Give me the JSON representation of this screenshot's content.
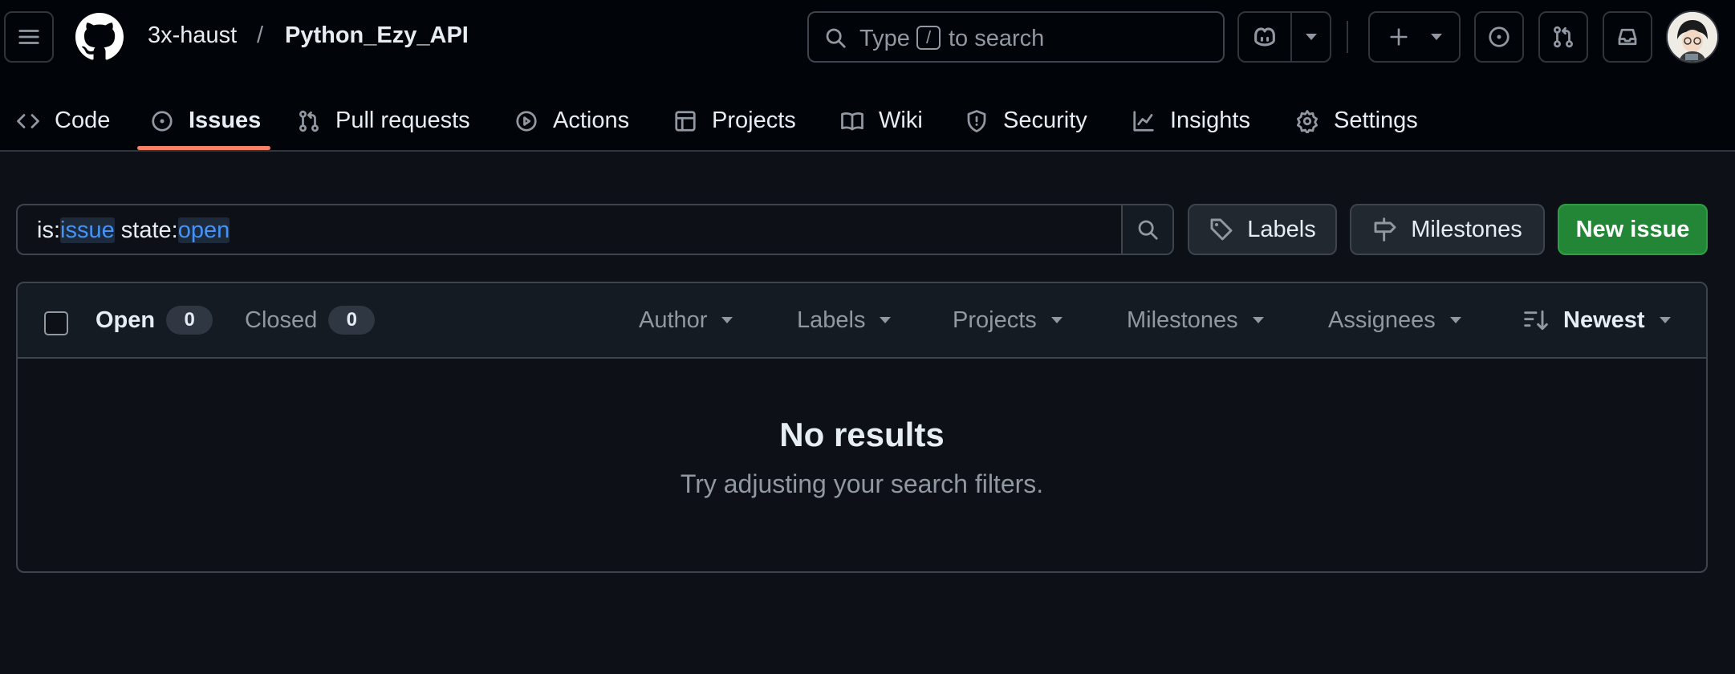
{
  "header": {
    "owner": "3x-haust",
    "separator": "/",
    "repo": "Python_Ezy_API",
    "search": {
      "prefix": "Type",
      "key": "/",
      "suffix": "to search"
    }
  },
  "tabs": [
    {
      "label": "Code",
      "icon": "code-icon"
    },
    {
      "label": "Issues",
      "icon": "issue-opened-icon",
      "active": true
    },
    {
      "label": "Pull requests",
      "icon": "git-pull-request-icon"
    },
    {
      "label": "Actions",
      "icon": "play-icon"
    },
    {
      "label": "Projects",
      "icon": "table-icon"
    },
    {
      "label": "Wiki",
      "icon": "book-icon"
    },
    {
      "label": "Security",
      "icon": "shield-icon"
    },
    {
      "label": "Insights",
      "icon": "graph-icon"
    },
    {
      "label": "Settings",
      "icon": "gear-icon"
    }
  ],
  "filter": {
    "parts": [
      {
        "text": "is:",
        "type": "key"
      },
      {
        "text": "issue",
        "type": "value"
      },
      {
        "text": " state:",
        "type": "key"
      },
      {
        "text": "open",
        "type": "value"
      }
    ]
  },
  "buttons": {
    "labels": "Labels",
    "milestones": "Milestones",
    "new_issue": "New issue"
  },
  "issues": {
    "open_label": "Open",
    "open_count": "0",
    "closed_label": "Closed",
    "closed_count": "0",
    "filters": {
      "author": "Author",
      "labels": "Labels",
      "projects": "Projects",
      "milestones": "Milestones",
      "assignees": "Assignees",
      "sort": "Newest"
    },
    "empty_title": "No results",
    "empty_hint": "Try adjusting your search filters."
  },
  "colors": {
    "accent_underline": "#f78166",
    "new_issue_green": "#238636",
    "query_value_blue": "#4493f8"
  }
}
